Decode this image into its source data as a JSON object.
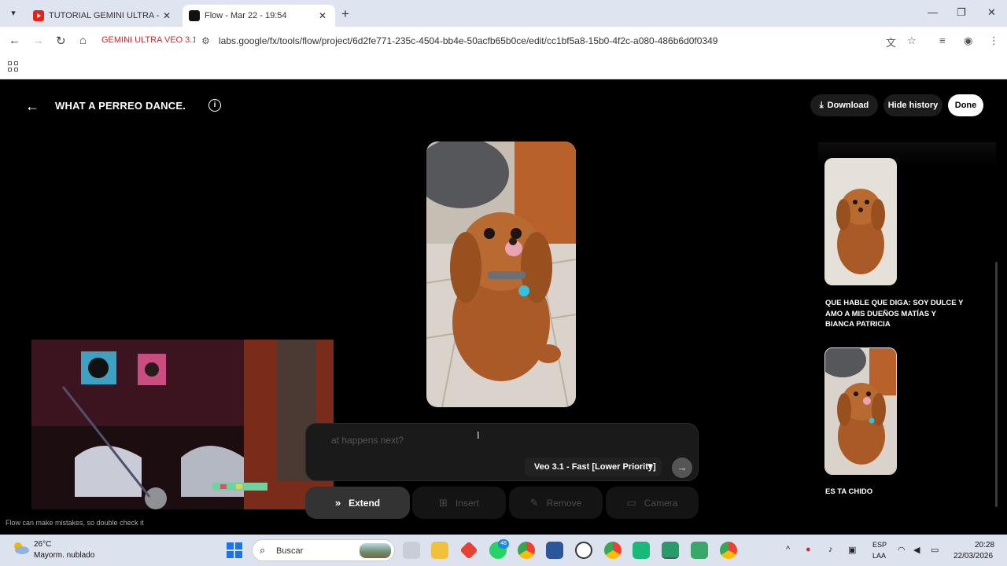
{
  "browser": {
    "tabs": [
      {
        "title": "TUTORIAL GEMINI ULTRA - VEO",
        "icon": "youtube-icon"
      },
      {
        "title": "Flow - Mar 22 - 19:54",
        "icon": "flow-icon"
      }
    ],
    "bookmark_label": "GEMINI ULTRA VEO 3.1",
    "url": "labs.google/fx/tools/flow/project/6d2fe771-235c-4504-bb4e-50acfb65b0ce/edit/cc1bf5a8-15b0-4f2c-a080-486b6d0f0349"
  },
  "app": {
    "project_title": "WHAT A PERREO DANCE.",
    "header_buttons": {
      "download": "Download",
      "hide_history": "Hide history",
      "done": "Done"
    },
    "prompt": {
      "placeholder": "at happens next?",
      "model": "Veo 3.1 - Fast [Lower Priority]"
    },
    "actions": {
      "extend": "Extend",
      "insert": "Insert",
      "remove": "Remove",
      "camera": "Camera"
    },
    "disclaimer": "Flow can make mistakes, so double check it",
    "history": [
      {
        "caption": "QUE HABLE QUE DIGA: SOY DULCE Y AMO A MIS DUEÑOS MATÍAS Y BIANCA PATRICIA"
      },
      {
        "caption": "ES TA CHIDO"
      }
    ]
  },
  "taskbar": {
    "weather_temp": "26°C",
    "weather_desc": "Mayorm. nublado",
    "search_label": "Buscar",
    "whatsapp_badge": "48",
    "lang_line1": "ESP",
    "lang_line2": "LAA",
    "time": "20:28",
    "date": "22/03/2026"
  },
  "colors": {
    "app_bg": "#000000",
    "accent_bookmark": "#d6282b",
    "tabbar_bg": "#dfe5f0",
    "taskbar_bg": "#dde3ee"
  }
}
